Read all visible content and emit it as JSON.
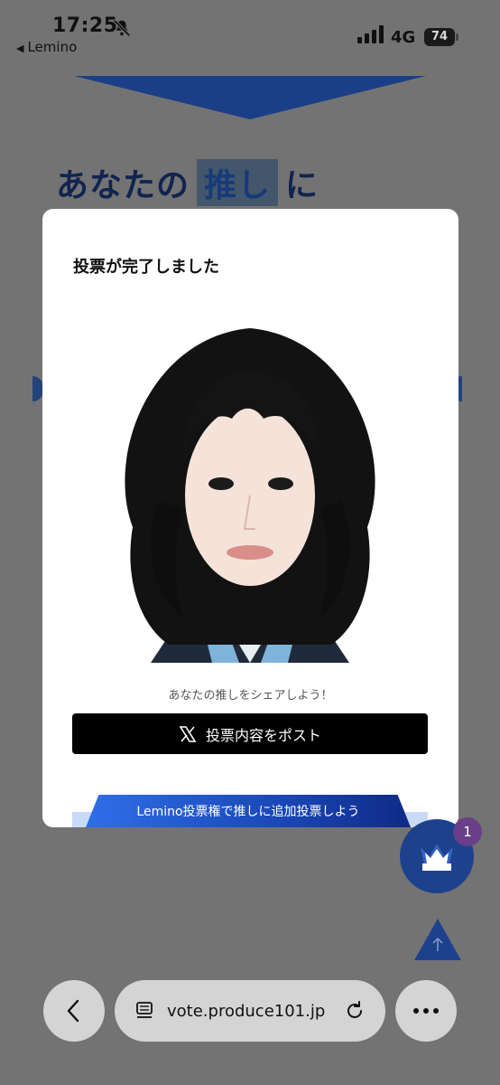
{
  "status_bar": {
    "time": "17:25",
    "back_app": "Lemino",
    "network": "4G",
    "battery": "74"
  },
  "background": {
    "hero_title_before": "あなたの",
    "hero_title_highlight": "推し",
    "hero_title_after": "に"
  },
  "modal": {
    "title": "投票が完了しました",
    "share_prompt": "あなたの推しをシェアしよう！",
    "post_button": "投票内容をポスト",
    "extra_vote_button": "Lemino投票権で推しに追加投票しよう"
  },
  "floating": {
    "badge_count": "1"
  },
  "browser": {
    "url": "vote.produce101.jp"
  },
  "colors": {
    "brand_navy": "#1d418c",
    "accent_blue": "#2f6ee8",
    "badge_purple": "#6a3f8a"
  },
  "icons": [
    "bell-slash-icon",
    "signal-icon",
    "battery-icon",
    "x-logo-icon",
    "crown-icon",
    "arrow-up-icon",
    "chevron-left-icon",
    "reader-icon",
    "reload-icon",
    "more-icon"
  ]
}
